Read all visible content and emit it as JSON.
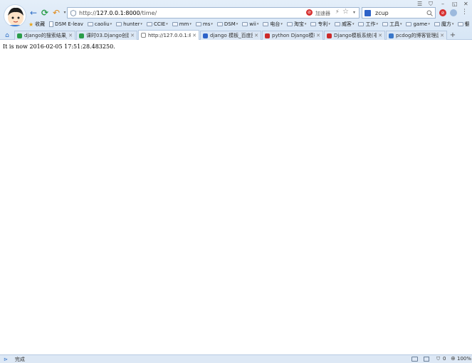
{
  "window_controls": {
    "menu": "☰",
    "shield": "⛉",
    "minimize": "–",
    "restore": "◱",
    "close": "✕"
  },
  "toolbar": {
    "back_icon": "←",
    "refresh_icon": "⟳",
    "undo_icon": "↶",
    "undo_caret": "▾"
  },
  "address": {
    "url_prefix": "http://",
    "url_host": "127.0.0.1:8000",
    "url_path": "/time/",
    "adblock_label": "加速器",
    "lightning": "⚡",
    "star": "☆",
    "caret": "▾"
  },
  "search": {
    "value": "zcup",
    "icon": "search-icon"
  },
  "bookmarks": [
    {
      "label": "收藏",
      "kind": "star",
      "caret": ""
    },
    {
      "label": "DSM E-leav",
      "kind": "page",
      "caret": ""
    },
    {
      "label": "caoliu",
      "kind": "folder",
      "caret": "▾"
    },
    {
      "label": "hunter",
      "kind": "folder",
      "caret": "▾"
    },
    {
      "label": "CCIE",
      "kind": "folder",
      "caret": "▾"
    },
    {
      "label": "mm",
      "kind": "folder",
      "caret": "▾"
    },
    {
      "label": "ms",
      "kind": "folder",
      "caret": "▾"
    },
    {
      "label": "DSM",
      "kind": "folder",
      "caret": "▾"
    },
    {
      "label": "wii",
      "kind": "folder",
      "caret": "▾"
    },
    {
      "label": "电台",
      "kind": "folder",
      "caret": "▾"
    },
    {
      "label": "淘宝",
      "kind": "folder",
      "caret": "▾"
    },
    {
      "label": "专利",
      "kind": "folder",
      "caret": "▾"
    },
    {
      "label": "威客",
      "kind": "folder",
      "caret": "▾"
    },
    {
      "label": "工作",
      "kind": "folder",
      "caret": "▾"
    },
    {
      "label": "工具",
      "kind": "folder",
      "caret": "▾"
    },
    {
      "label": "game",
      "kind": "folder",
      "caret": "▾"
    },
    {
      "label": "魔方",
      "kind": "folder",
      "caret": "▾"
    },
    {
      "label": "翻",
      "kind": "folder",
      "caret": "▾"
    }
  ],
  "bookmarks_more": "»",
  "tabs": [
    {
      "label": "django的搜索结果_3",
      "icon_color": "#2a9d4a",
      "active": false
    },
    {
      "label": "课时03.Django创建",
      "icon_color": "#2a9d4a",
      "active": false
    },
    {
      "label": "http://127.0.0.1:800",
      "icon_color": "#888888",
      "active": true
    },
    {
      "label": "django 模板_百度图",
      "icon_color": "#2d62c8",
      "active": false
    },
    {
      "label": "python Django模板",
      "icon_color": "#cc2a2a",
      "active": false
    },
    {
      "label": "Django模板系统(非",
      "icon_color": "#cc2a2a",
      "active": false
    },
    {
      "label": "pcdog的博客管理后",
      "icon_color": "#3a77c9",
      "active": false
    }
  ],
  "new_tab": "+",
  "page": {
    "message": "It is now 2016-02-05 17:51:28.483250."
  },
  "status": {
    "text": "完成",
    "counter": "0",
    "zoom": "100%"
  }
}
